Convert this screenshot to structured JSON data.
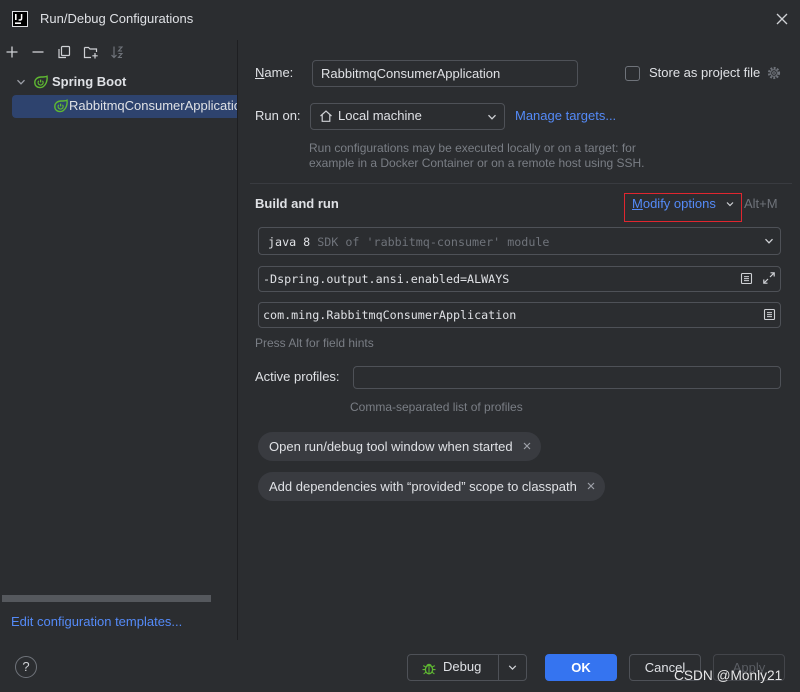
{
  "window": {
    "title": "Run/Debug Configurations",
    "logo_text": "IJ",
    "icons": {
      "app": "intellij-icon",
      "close": "close-icon"
    }
  },
  "sidebar": {
    "toolbar_icons": [
      "plus-icon",
      "minus-icon",
      "copy-icon",
      "new-folder-icon",
      "sort-icon"
    ],
    "tree": {
      "group_label": "Spring Boot",
      "group_icon": "spring-boot-icon",
      "expanded": true,
      "items": [
        {
          "label": "RabbitmqConsumerApplication",
          "icon": "spring-boot-icon",
          "selected": true
        }
      ]
    },
    "templates_link": "Edit configuration templates..."
  },
  "form": {
    "name": {
      "label": "Name:",
      "value": "RabbitmqConsumerApplication"
    },
    "store_as_project_file": {
      "label": "Store as project file",
      "checked": false,
      "icon": "gear-icon"
    },
    "run_on": {
      "label": "Run on:",
      "value": "Local machine",
      "icon": "home-icon",
      "manage_link": "Manage targets...",
      "hint_lines": [
        "Run configurations may be executed locally or on a target: for",
        "example in a Docker Container or on a remote host using SSH."
      ]
    },
    "build_and_run": {
      "title": "Build and run",
      "modify_options": "Modify options",
      "modify_shortcut": "Alt+M",
      "sdk": {
        "version": "java 8",
        "description": "SDK of 'rabbitmq-consumer' module"
      },
      "vm_options": "-Dspring.output.ansi.enabled=ALWAYS",
      "main_class": "com.ming.RabbitmqConsumerApplication",
      "field_hint": "Press Alt for field hints"
    },
    "active_profiles": {
      "label": "Active profiles:",
      "value": "",
      "hint": "Comma-separated list of profiles"
    },
    "option_chips": [
      {
        "label": "Open run/debug tool window when started"
      },
      {
        "label": "Add dependencies with “provided” scope to classpath"
      }
    ]
  },
  "footer": {
    "help_label": "?",
    "debug_label": "Debug",
    "debug_icon": "bug-icon",
    "ok_label": "OK",
    "cancel_label": "Cancel",
    "apply_label": "Apply",
    "apply_enabled": false
  },
  "watermark": "CSDN @Monly21",
  "colors": {
    "background": "#2b2d30",
    "text": "#dfe1e5",
    "muted_text": "#7a7e85",
    "link": "#548af7",
    "accent_button": "#3574f0",
    "selection": "#2e436e",
    "border": "#4e5157",
    "chip": "#393b40",
    "highlight_box": "#e0262f",
    "spring_green": "#5fb832"
  }
}
